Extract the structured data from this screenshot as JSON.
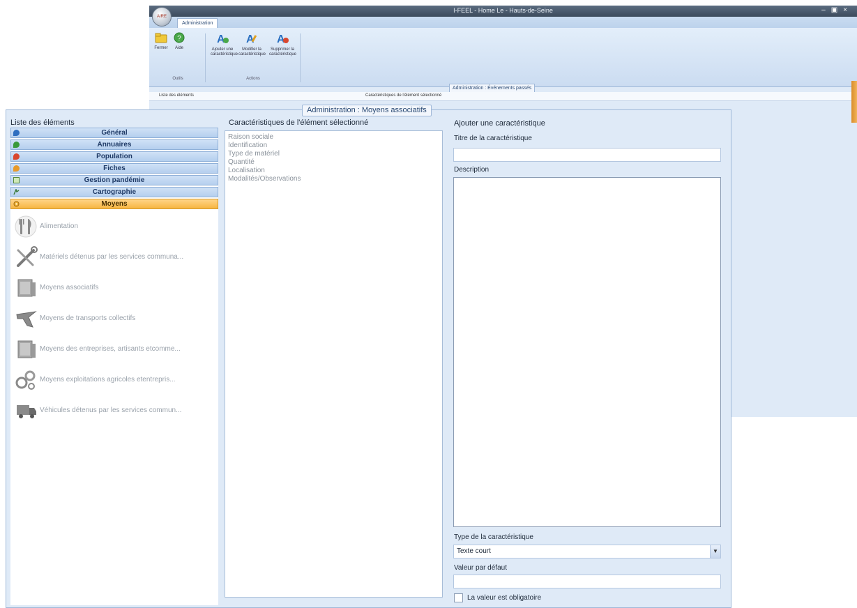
{
  "background_window": {
    "title": "I-FEEL - Home Le - Hauts-de-Seine",
    "ribbon_tab": "Administration",
    "buttons": [
      {
        "label": "Fermer",
        "icon": "folder-icon"
      },
      {
        "label": "Aide",
        "icon": "help-icon"
      },
      {
        "label": "Ajouter une caractéristique",
        "icon": "add-characteristic-icon"
      },
      {
        "label": "Modifier la caractéristique",
        "icon": "edit-characteristic-icon"
      },
      {
        "label": "Supprimer la caractéristique",
        "icon": "delete-characteristic-icon"
      }
    ],
    "groups": [
      "Outils",
      "Actions"
    ],
    "panel_title": "Administration : Événements passés",
    "strip_left": "Liste des éléments",
    "strip_right": "Caractéristiques de l'élément sélectionné"
  },
  "dialog": {
    "title": "Administration : Moyens associatifs",
    "left": {
      "header": "Liste des éléments",
      "categories": [
        {
          "label": "Général",
          "icon": "chat-blue-icon",
          "color": "#2f6fc0",
          "active": false
        },
        {
          "label": "Annuaires",
          "icon": "chat-green-icon",
          "color": "#3a9a3a",
          "active": false
        },
        {
          "label": "Population",
          "icon": "chat-red-icon",
          "color": "#d9462e",
          "active": false
        },
        {
          "label": "Fiches",
          "icon": "chat-orange-icon",
          "color": "#e89a2a",
          "active": false
        },
        {
          "label": "Gestion pandémie",
          "icon": "chart-icon",
          "color": "#5a8a3a",
          "active": false
        },
        {
          "label": "Cartographie",
          "icon": "map-pin-icon",
          "color": "#3a7a3a",
          "active": false
        },
        {
          "label": "Moyens",
          "icon": "gear-icon",
          "color": "#e8a020",
          "active": true
        }
      ],
      "sub_items": [
        {
          "label": "Alimentation",
          "icon": "fork-knife-icon"
        },
        {
          "label": "Matériels détenus par les services communa...",
          "icon": "tools-icon"
        },
        {
          "label": "Moyens associatifs",
          "icon": "book-icon"
        },
        {
          "label": "Moyens de transports collectifs",
          "icon": "plane-icon"
        },
        {
          "label": "Moyens des entreprises, artisants etcomme...",
          "icon": "book-icon"
        },
        {
          "label": "Moyens exploitations agricoles etentrepris...",
          "icon": "gears-icon"
        },
        {
          "label": "Véhicules détenus par les services commun...",
          "icon": "truck-icon"
        }
      ]
    },
    "middle": {
      "header": "Caractéristiques de l'élément sélectionné",
      "items": [
        "Raison sociale",
        "Identification",
        "Type de matériel",
        "Quantité",
        "Localisation",
        "Modalités/Observations"
      ]
    },
    "right": {
      "header": "Ajouter une caractéristique",
      "title_label": "Titre de la caractéristique",
      "title_value": "",
      "description_label": "Description",
      "type_label": "Type de la caractéristique",
      "type_value": "Texte court",
      "default_label": "Valeur par défaut",
      "default_value": "",
      "mandatory_label": "La valeur est obligatoire",
      "mandatory_checked": false
    }
  }
}
